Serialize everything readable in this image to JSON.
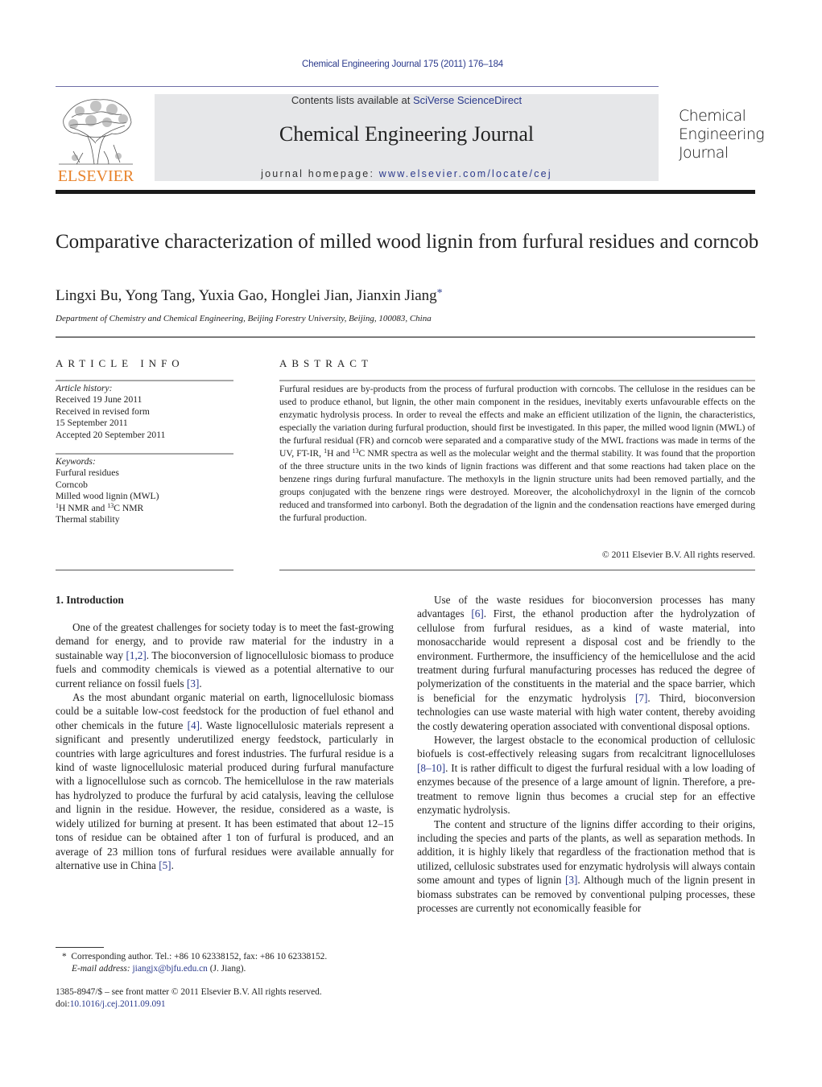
{
  "header": {
    "citation": "Chemical Engineering Journal 175 (2011) 176–184",
    "contents_prefix": "Contents lists available at ",
    "contents_link": "SciVerse ScienceDirect",
    "journal_name": "Chemical Engineering Journal",
    "homepage_prefix": "journal homepage: ",
    "homepage_link": "www.elsevier.com/locate/cej",
    "publisher_logo_text": "ELSEVIER",
    "cover_title_lines": [
      "Chemical",
      "Engineering",
      "Journal"
    ]
  },
  "article": {
    "title": "Comparative characterization of milled wood lignin from furfural residues and corncob",
    "authors": "Lingxi Bu, Yong Tang, Yuxia Gao, Honglei Jian, Jianxin Jiang",
    "corresponding_mark": "*",
    "affiliation": "Department of Chemistry and Chemical Engineering, Beijing Forestry University, Beijing, 100083, China"
  },
  "article_info": {
    "heading": "ARTICLE INFO",
    "history_label": "Article history:",
    "history": [
      "Received 19 June 2011",
      "Received in revised form",
      "15 September 2011",
      "Accepted 20 September 2011"
    ],
    "keywords_label": "Keywords:",
    "keywords": [
      "Furfural residues",
      "Corncob",
      "Milled wood lignin (MWL)"
    ],
    "keyword_nmr": {
      "sup1": "1",
      "part1": "H NMR and ",
      "sup2": "13",
      "part2": "C NMR"
    },
    "keyword_last": "Thermal stability"
  },
  "abstract": {
    "heading": "ABSTRACT",
    "text_1": "Furfural residues are by-products from the process of furfural production with corncobs. The cellulose in the residues can be used to produce ethanol, but lignin, the other main component in the residues, inevitably exerts unfavourable effects on the enzymatic hydrolysis process. In order to reveal the effects and make an efficient utilization of the lignin, the characteristics, especially the variation during furfural production, should first be investigated. In this paper, the milled wood lignin (MWL) of the furfural residual (FR) and corncob were separated and a comparative study of the MWL fractions was made in terms of the UV, FT-IR, ",
    "sup1": "1",
    "text_2": "H and ",
    "sup2": "13",
    "text_3": "C NMR spectra as well as the molecular weight and the thermal stability. It was found that the proportion of the three structure units in the two kinds of lignin fractions was different and that some reactions had taken place on the benzene rings during furfural manufacture. The methoxyls in the lignin structure units had been removed partially, and the groups conjugated with the benzene rings were destroyed. Moreover, the alcoholichydroxyl in the lignin of the corncob reduced and transformed into carbonyl. Both the degradation of the lignin and the condensation reactions have emerged during the furfural production.",
    "copyright": "© 2011 Elsevier B.V. All rights reserved."
  },
  "introduction": {
    "heading": "1.  Introduction",
    "p1": {
      "a": "One of the greatest challenges for society today is to meet the fast-growing demand for energy, and to provide raw material for the industry in a sustainable way ",
      "ref1": "[1,2]",
      "b": ". The bioconversion of lignocellulosic biomass to produce fuels and commodity chemicals is viewed as a potential alternative to our current reliance on fossil fuels ",
      "ref2": "[3]",
      "c": "."
    },
    "p2": {
      "a": "As the most abundant organic material on earth, lignocellulosic biomass could be a suitable low-cost feedstock for the production of fuel ethanol and other chemicals in the future ",
      "ref1": "[4]",
      "b": ". Waste lignocellulosic materials represent a significant and presently underutilized energy feedstock, particularly in countries with large agricultures and forest industries. The furfural residue is a kind of waste lignocellulosic material produced during furfural manufacture with a lignocellulose such as corncob. The hemicellulose in the raw materials has hydrolyzed to produce the furfural by acid catalysis, leaving the cellulose and lignin in the residue. However, the residue, considered as a waste, is widely utilized for burning at present. It has been estimated that about 12–15 tons of residue can be obtained after 1 ton of furfural is produced, and an average of 23 million tons of furfural residues were available annually for alternative use in China ",
      "ref2": "[5]",
      "c": "."
    },
    "p3": {
      "a": "Use of the waste residues for bioconversion processes has many advantages ",
      "ref1": "[6]",
      "b": ". First, the ethanol production after the hydrolyzation of cellulose from furfural residues, as a kind of waste material, into monosaccharide would represent a disposal cost and be friendly to the environment. Furthermore, the insufficiency of the hemicellulose and the acid treatment during furfural manufacturing processes has reduced the degree of polymerization of the constituents in the material and the space barrier, which is beneficial for the enzymatic hydrolysis ",
      "ref2": "[7]",
      "c": ". Third, bioconversion technologies can use waste material with high water content, thereby avoiding the costly dewatering operation associated with conventional disposal options."
    },
    "p4": {
      "a": "However, the largest obstacle to the economical production of cellulosic biofuels is cost-effectively releasing sugars from recalcitrant lignocelluloses ",
      "ref1": "[8–10]",
      "b": ". It is rather difficult to digest the furfural residual with a low loading of enzymes because of the presence of a large amount of lignin. Therefore, a pre-treatment to remove lignin thus becomes a crucial step for an effective enzymatic hydrolysis."
    },
    "p5": {
      "a": "The content and structure of the lignins differ according to their origins, including the species and parts of the plants, as well as separation methods. In addition, it is highly likely that regardless of the fractionation method that is utilized, cellulosic substrates used for enzymatic hydrolysis will always contain some amount and types of lignin ",
      "ref1": "[3]",
      "b": ". Although much of the lignin present in biomass substrates can be removed by conventional pulping processes, these processes are currently not economically feasible for"
    }
  },
  "footnotes": {
    "star": "*",
    "corresponding": "Corresponding author. Tel.: +86 10 62338152, fax: +86 10 62338152.",
    "email_label": "E-mail address: ",
    "email": "jiangjx@bjfu.edu.cn",
    "email_suffix": " (J. Jiang).",
    "front_matter": "1385-8947/$ – see front matter © 2011 Elsevier B.V. All rights reserved.",
    "doi_prefix": "doi:",
    "doi": "10.1016/j.cej.2011.09.091"
  }
}
